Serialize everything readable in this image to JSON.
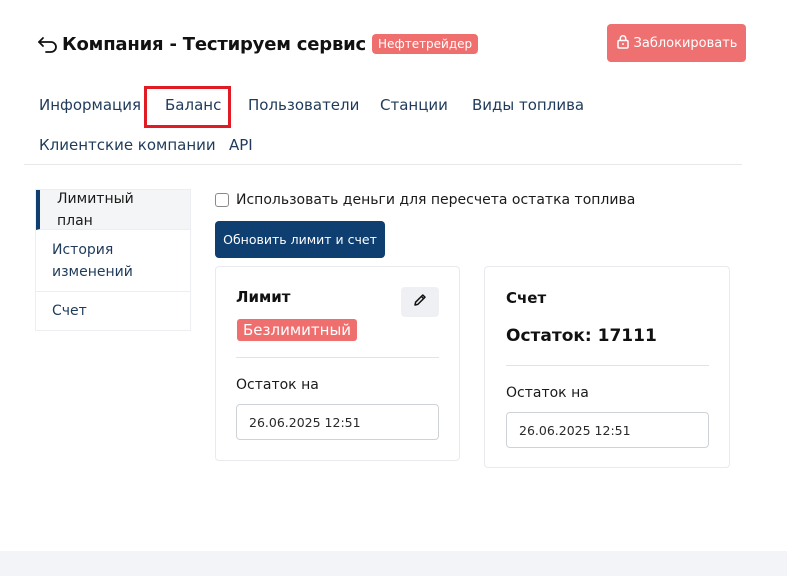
{
  "header": {
    "title": "Компания - Тестируем сервис",
    "role_badge": "Нефтетрейдер",
    "block_button": "Заблокировать"
  },
  "tabs": [
    {
      "label": "Информация"
    },
    {
      "label": "Баланс",
      "active": true
    },
    {
      "label": "Пользователи"
    },
    {
      "label": "Станции"
    },
    {
      "label": "Виды топлива"
    },
    {
      "label": "Клиентские компании"
    },
    {
      "label": "API"
    }
  ],
  "side_menu": [
    {
      "label": "Лимитный план",
      "active": true
    },
    {
      "label": "История изменений"
    },
    {
      "label": "Счет"
    }
  ],
  "options": {
    "use_money_label": "Использовать деньги для пересчета остатка топлива",
    "use_money_checked": false
  },
  "update_button": "Обновить лимит и счет",
  "limit_card": {
    "title": "Лимит",
    "badge": "Безлимитный",
    "remainder_label": "Остаток на",
    "date_value": "26.06.2025 12:51"
  },
  "account_card": {
    "title": "Счет",
    "balance": "Остаток: 17111",
    "remainder_label": "Остаток на",
    "date_value": "26.06.2025 12:51"
  },
  "colors": {
    "primary": "#0e3f70",
    "danger": "#ef6f6f",
    "highlight_frame": "#e01b24"
  },
  "icons": {
    "back": "back-arrow-icon",
    "lock": "lock-icon",
    "edit": "pencil-icon"
  }
}
